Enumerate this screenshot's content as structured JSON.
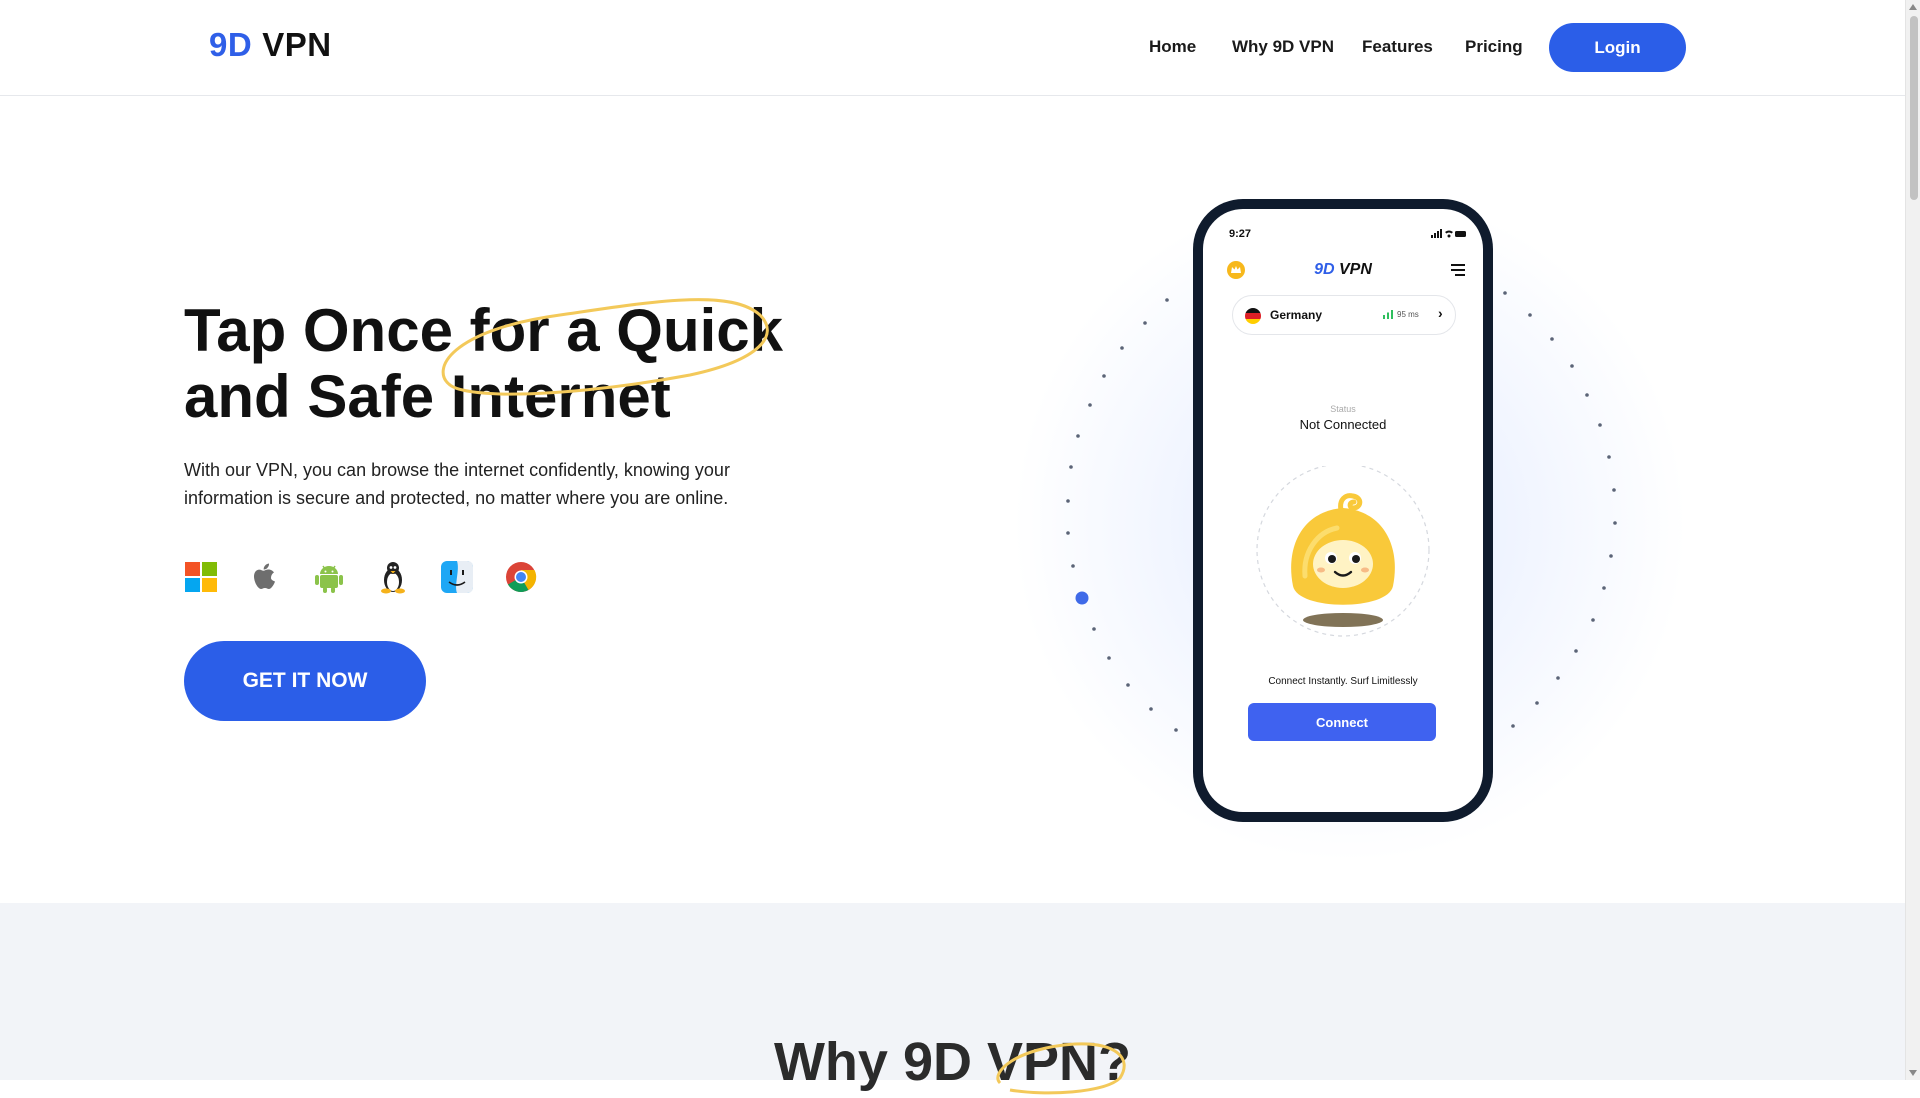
{
  "header": {
    "logo_accent": "9D",
    "logo_rest": "VPN",
    "nav": [
      "Home",
      "Why 9D VPN",
      "Features",
      "Pricing"
    ],
    "login_label": "Login"
  },
  "hero": {
    "title_line1": "Tap Once for a Quick",
    "title_line2": "and Safe Internet",
    "description": "With our VPN, you can browse the internet confidently, knowing your information is secure and protected, no matter where you are online.",
    "platforms": [
      "windows-icon",
      "apple-icon",
      "android-icon",
      "linux-icon",
      "macos-finder-icon",
      "chrome-icon"
    ],
    "cta_label": "GET IT NOW"
  },
  "phone": {
    "time": "9:27",
    "app_accent": "9D",
    "app_rest": "VPN",
    "country": "Germany",
    "ping": "95 ms",
    "status_label": "Status",
    "status_value": "Not Connected",
    "tagline": "Connect Instantly. Surf Limitlessly",
    "connect_label": "Connect"
  },
  "section2": {
    "title": "Why 9D VPN?"
  },
  "colors": {
    "primary": "#2b5ee8",
    "accent_ring": "#f3c95a",
    "phone_frame": "#0f1b2d",
    "section_bg": "#f2f4f8"
  }
}
